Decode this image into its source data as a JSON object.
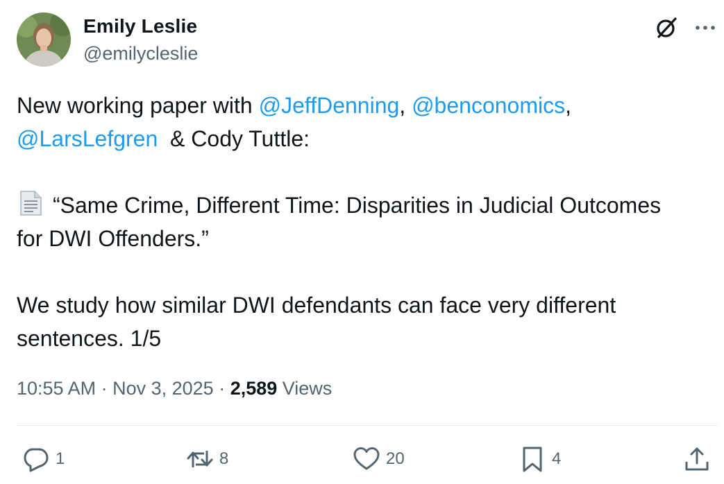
{
  "author": {
    "name": "Emily Leslie",
    "handle": "@emilycleslie"
  },
  "header_icons": {
    "grok": "grok-icon",
    "more": "more-options-icon"
  },
  "tweet": {
    "line1_prefix": "New working paper with ",
    "mention1": "@JeffDenning",
    "sep1": ", ",
    "mention2": "@benconomics",
    "sep2": ",",
    "mention3": "@LarsLefgren",
    "line2_suffix": "  & Cody Tuttle:",
    "doc_icon": "page-facing-up-icon",
    "paper_title_line1": "“Same Crime, Different Time: Disparities in Judicial Outcomes",
    "paper_title_line2": "for DWI Offenders.”",
    "body_line1": "We study how similar DWI defendants can face very different",
    "body_line2": "sentences. 1/5"
  },
  "meta": {
    "time": "10:55 AM",
    "sep1": " · ",
    "date": "Nov 3, 2025",
    "sep2": " · ",
    "views_count": "2,589",
    "views_label": " Views"
  },
  "actions": {
    "reply": {
      "icon": "reply-icon",
      "count": "1"
    },
    "repost": {
      "icon": "repost-icon",
      "count": "8"
    },
    "like": {
      "icon": "heart-icon",
      "count": "20"
    },
    "bookmark": {
      "icon": "bookmark-icon",
      "count": "4"
    },
    "share": {
      "icon": "share-icon"
    }
  },
  "colors": {
    "text": "#0f1419",
    "secondary": "#536471",
    "link": "#1d9bf0",
    "divider": "#e6ecf0"
  }
}
